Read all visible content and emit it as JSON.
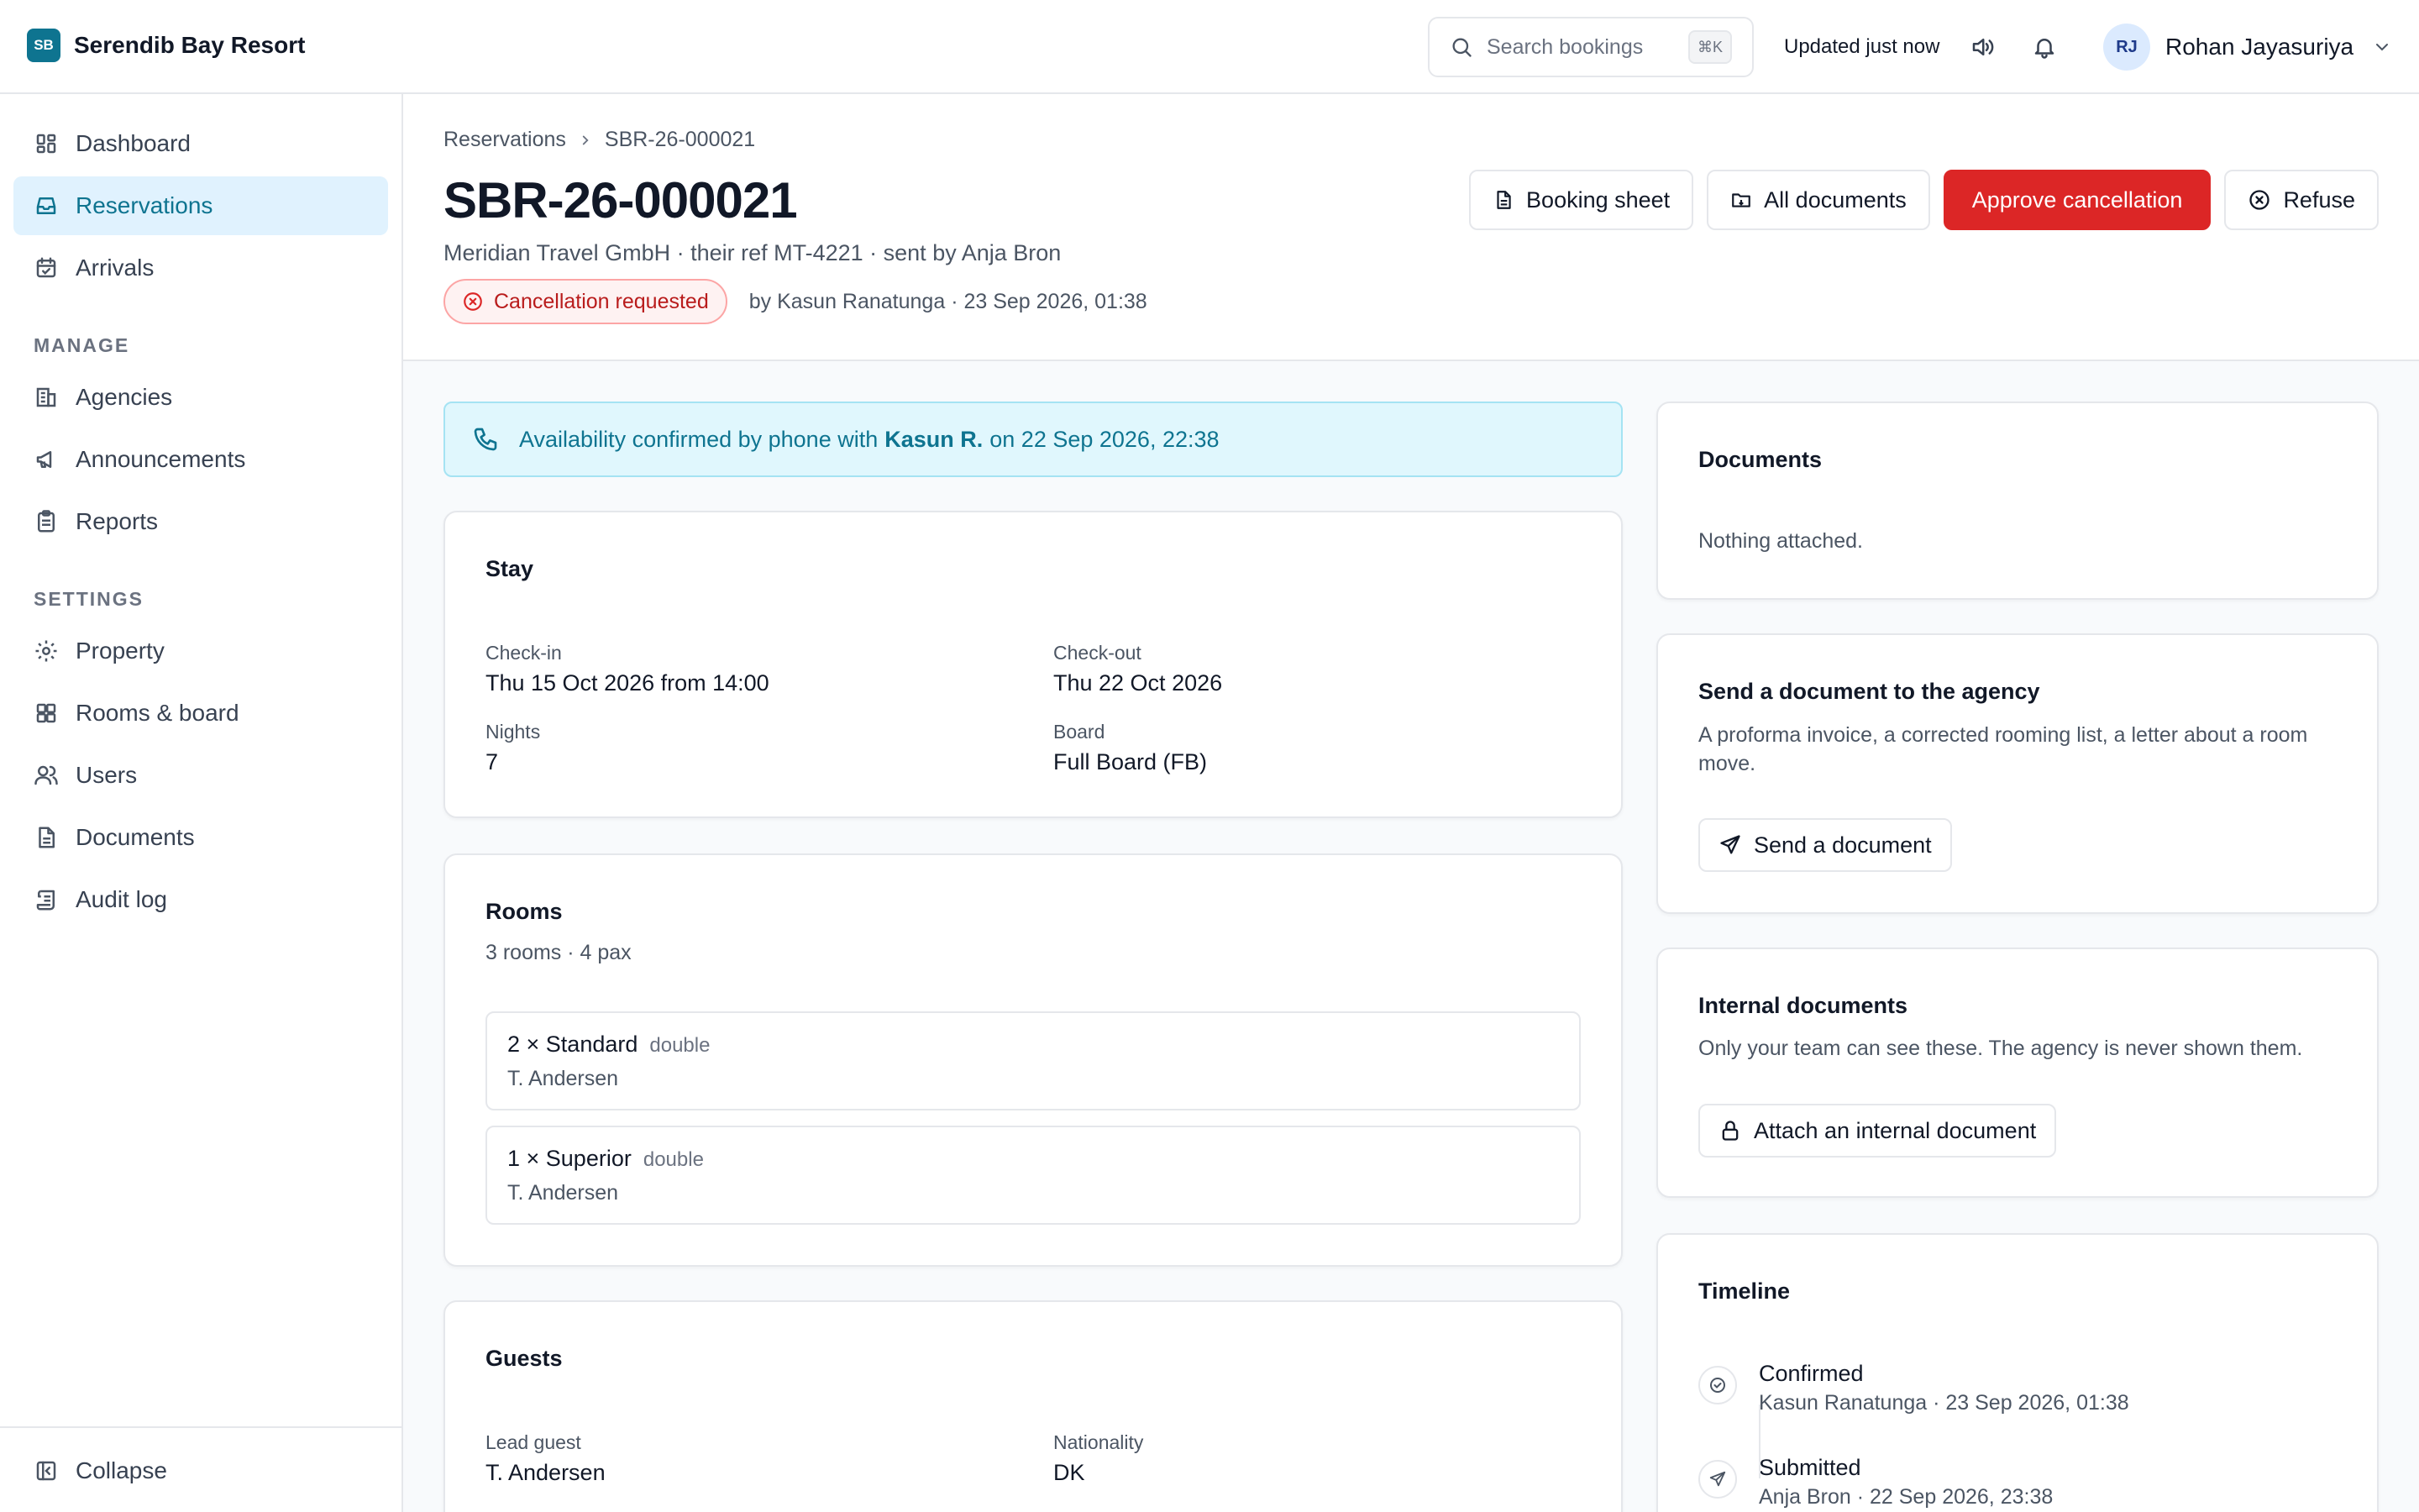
{
  "brand": {
    "initials": "SB",
    "name": "Serendib Bay Resort"
  },
  "topbar": {
    "search_placeholder": "Search bookings",
    "search_shortcut": "⌘K",
    "updated": "Updated just now",
    "user": {
      "initials": "RJ",
      "name": "Rohan Jayasuriya"
    }
  },
  "sidebar": {
    "items": [
      {
        "label": "Dashboard",
        "icon": "dashboard-icon"
      },
      {
        "label": "Reservations",
        "icon": "inbox-icon",
        "active": true
      },
      {
        "label": "Arrivals",
        "icon": "calendar-check-icon"
      }
    ],
    "manage_heading": "MANAGE",
    "manage": [
      {
        "label": "Agencies",
        "icon": "building-icon"
      },
      {
        "label": "Announcements",
        "icon": "megaphone-icon"
      },
      {
        "label": "Reports",
        "icon": "clipboard-icon"
      }
    ],
    "settings_heading": "SETTINGS",
    "settings": [
      {
        "label": "Property",
        "icon": "gear-icon"
      },
      {
        "label": "Rooms & board",
        "icon": "grid-icon"
      },
      {
        "label": "Users",
        "icon": "users-icon"
      },
      {
        "label": "Documents",
        "icon": "document-icon"
      },
      {
        "label": "Audit log",
        "icon": "scroll-icon"
      }
    ],
    "collapse_label": "Collapse"
  },
  "header": {
    "breadcrumb": [
      "Reservations",
      "SBR-26-000021"
    ],
    "title": "SBR-26-000021",
    "subtitle": "Meridian Travel GmbH · their ref MT-4221 · sent by Anja Bron",
    "status_badge": "Cancellation requested",
    "status_meta": "by Kasun Ranatunga · 23 Sep 2026, 01:38",
    "actions": {
      "booking_sheet": "Booking sheet",
      "all_documents": "All documents",
      "approve": "Approve cancellation",
      "refuse": "Refuse"
    }
  },
  "alert": {
    "prefix": "Availability confirmed by phone with",
    "person": "Kasun R.",
    "suffix": "on 22 Sep 2026, 22:38"
  },
  "stay": {
    "title": "Stay",
    "checkin_label": "Check-in",
    "checkin_value": "Thu 15 Oct 2026 from 14:00",
    "checkout_label": "Check-out",
    "checkout_value": "Thu 22 Oct 2026",
    "nights_label": "Nights",
    "nights_value": "7",
    "board_label": "Board",
    "board_value": "Full Board (FB)"
  },
  "rooms": {
    "title": "Rooms",
    "summary": "3 rooms · 4 pax",
    "list": [
      {
        "type": "2 × Standard",
        "bed": "double",
        "guest": "T. Andersen"
      },
      {
        "type": "1 × Superior",
        "bed": "double",
        "guest": "T. Andersen"
      }
    ]
  },
  "guests": {
    "title": "Guests",
    "lead_label": "Lead guest",
    "lead_value": "T. Andersen",
    "nationality_label": "Nationality",
    "nationality_value": "DK"
  },
  "documents": {
    "title": "Documents",
    "empty": "Nothing attached."
  },
  "send_doc": {
    "title": "Send a document to the agency",
    "description": "A proforma invoice, a corrected rooming list, a letter about a room move.",
    "button": "Send a document"
  },
  "internal_docs": {
    "title": "Internal documents",
    "description": "Only your team can see these. The agency is never shown them.",
    "button": "Attach an internal document"
  },
  "timeline": {
    "title": "Timeline",
    "events": [
      {
        "title": "Confirmed",
        "meta": "Kasun Ranatunga · 23 Sep 2026, 01:38"
      },
      {
        "title": "Submitted",
        "meta": "Anja Bron · 22 Sep 2026, 23:38"
      }
    ]
  },
  "colors": {
    "accent": "#0e7490",
    "danger": "#dc2626",
    "active_nav_bg": "#e0f2fe",
    "alert_bg": "#e0f7fd"
  }
}
